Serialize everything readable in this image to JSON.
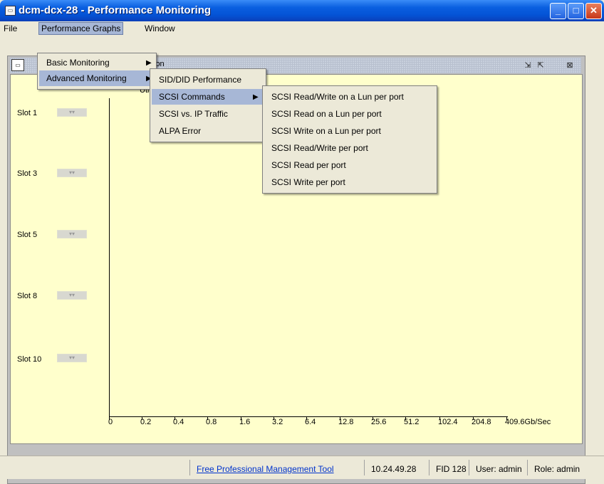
{
  "window": {
    "title": "dcm-dcx-28 - Performance Monitoring",
    "app_icon": "monitor-icon"
  },
  "window_buttons": {
    "minimize": "_",
    "maximize": "□",
    "close": "✕"
  },
  "menubar": [
    "File",
    "Performance Graphs",
    "Window"
  ],
  "menu_level1": [
    "Basic Monitoring",
    "Advanced Monitoring"
  ],
  "menu_level2": [
    "SID/DID Performance",
    "SCSI Commands",
    "SCSI vs. IP Traffic",
    "ALPA Error"
  ],
  "menu_level3": [
    "SCSI Read/Write on a Lun per port",
    "SCSI Read on a Lun per port",
    "SCSI Write on a Lun per port",
    "SCSI Read/Write per port",
    "SCSI Read per port",
    "SCSI Write per port"
  ],
  "inner_window": {
    "title_partial": "ion",
    "sub_partial": "Utilizati"
  },
  "slots": [
    "Slot 1",
    "Slot 3",
    "Slot 5",
    "Slot 8",
    "Slot 10"
  ],
  "x_ticks": [
    "0",
    "0.2",
    "0.4",
    "0.8",
    "1.6",
    "3.2",
    "6.4",
    "12.8",
    "25.6",
    "51.2",
    "102.4",
    "204.8",
    "409.6Gb/Sec"
  ],
  "status": {
    "link": "Free Professional Management Tool",
    "ip": "10.24.49.28",
    "fid": "FID 128",
    "user": "User: admin",
    "role": "Role: admin"
  }
}
